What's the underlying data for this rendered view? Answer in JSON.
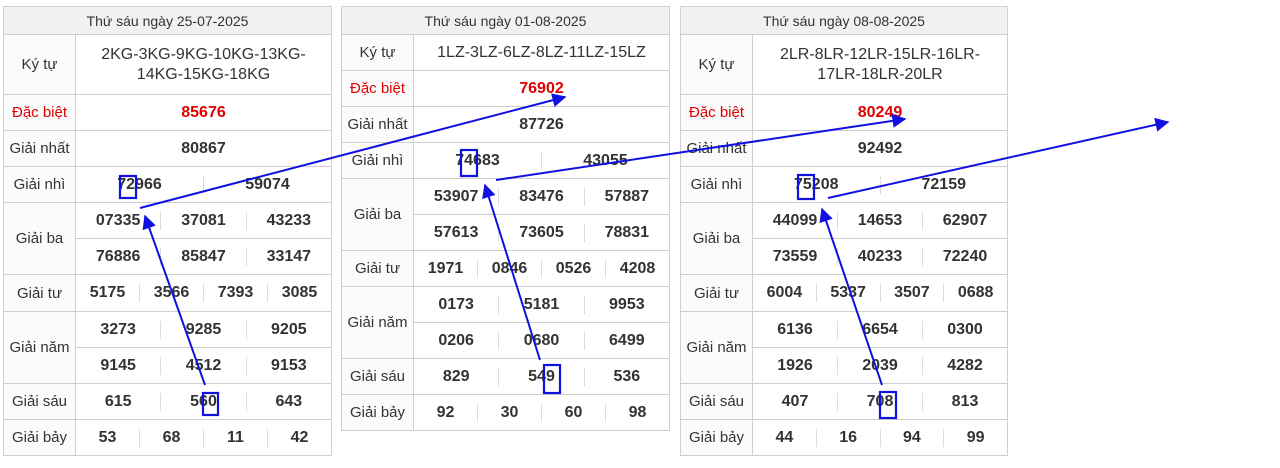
{
  "labels": {
    "kytu": "Ký tự",
    "db": "Đặc biệt",
    "g1": "Giải nhất",
    "g2": "Giải nhì",
    "g3": "Giải ba",
    "g4": "Giải tư",
    "g5": "Giải năm",
    "g6": "Giải sáu",
    "g7": "Giải bảy"
  },
  "tables": [
    {
      "title": "Thứ sáu ngày 25-07-2025",
      "code": "2KG-3KG-9KG-10KG-13KG-14KG-15KG-18KG",
      "db": "85676",
      "g1": "80867",
      "g2": [
        "72966",
        "59074"
      ],
      "g3": [
        "07335",
        "37081",
        "43233",
        "76886",
        "85847",
        "33147"
      ],
      "g4": [
        "5175",
        "3566",
        "7393",
        "3085"
      ],
      "g5": [
        "3273",
        "9285",
        "9205",
        "9145",
        "4512",
        "9153"
      ],
      "g6": [
        "615",
        "560",
        "643"
      ],
      "g7": [
        "53",
        "68",
        "11",
        "42"
      ]
    },
    {
      "title": "Thứ sáu ngày 01-08-2025",
      "code": "1LZ-3LZ-6LZ-8LZ-11LZ-15LZ",
      "db": "76902",
      "g1": "87726",
      "g2": [
        "74683",
        "43055"
      ],
      "g3": [
        "53907",
        "83476",
        "57887",
        "57613",
        "73605",
        "78831"
      ],
      "g4": [
        "1971",
        "0846",
        "0526",
        "4208"
      ],
      "g5": [
        "0173",
        "5181",
        "9953",
        "0206",
        "0680",
        "6499"
      ],
      "g6": [
        "829",
        "549",
        "536"
      ],
      "g7": [
        "92",
        "30",
        "60",
        "98"
      ]
    },
    {
      "title": "Thứ sáu ngày 08-08-2025",
      "code": "2LR-8LR-12LR-15LR-16LR-17LR-18LR-20LR",
      "db": "80249",
      "g1": "92492",
      "g2": [
        "75208",
        "72159"
      ],
      "g3": [
        "44099",
        "14653",
        "62907",
        "73559",
        "40233",
        "72240"
      ],
      "g4": [
        "6004",
        "5337",
        "3507",
        "0688"
      ],
      "g5": [
        "6136",
        "6654",
        "0300",
        "1926",
        "2039",
        "4282"
      ],
      "g6": [
        "407",
        "708",
        "813"
      ],
      "g7": [
        "44",
        "16",
        "94",
        "99"
      ]
    }
  ],
  "colors": {
    "special": "#e00000",
    "annotation": "#1010e0",
    "border": "#cfcfcf"
  }
}
